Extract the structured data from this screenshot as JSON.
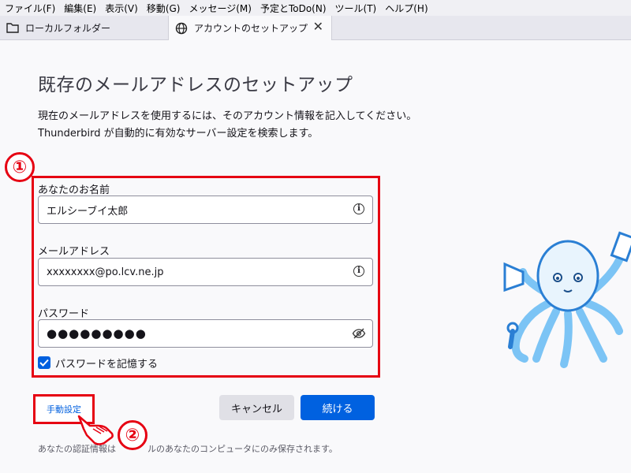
{
  "menu": [
    "ファイル(F)",
    "編集(E)",
    "表示(V)",
    "移動(G)",
    "メッセージ(M)",
    "予定とToDo(N)",
    "ツール(T)",
    "ヘルプ(H)"
  ],
  "tabs": {
    "folder": {
      "label": "ローカルフォルダー",
      "icon": "folder-icon"
    },
    "setup": {
      "label": "アカウントのセットアップ",
      "icon": "globe-icon",
      "close": "✕"
    }
  },
  "page": {
    "title": "既存のメールアドレスのセットアップ",
    "desc_line1": "現在のメールアドレスを使用するには、そのアカウント情報を記入してください。",
    "desc_line2": "Thunderbird が自動的に有効なサーバー設定を検索します。"
  },
  "annotations": {
    "marker1": "①",
    "marker2": "②",
    "accent": "#e60012"
  },
  "form": {
    "name_label": "あなたのお名前",
    "name_value": "エルシーブイ太郎",
    "email_label": "メールアドレス",
    "email_value": "xxxxxxxx@po.lcv.ne.jp",
    "password_label": "パスワード",
    "password_value": "●●●●●●●●●",
    "remember_label": "パスワードを記憶する",
    "remember_checked": true
  },
  "buttons": {
    "manual": "手動設定",
    "cancel": "キャンセル",
    "continue": "続ける"
  },
  "footnote": "あなたの認証情報は",
  "footnote_tail": "ルのあなたのコンピュータにのみ保存されます。",
  "colors": {
    "primary": "#0061e0",
    "link": "#0060df"
  }
}
